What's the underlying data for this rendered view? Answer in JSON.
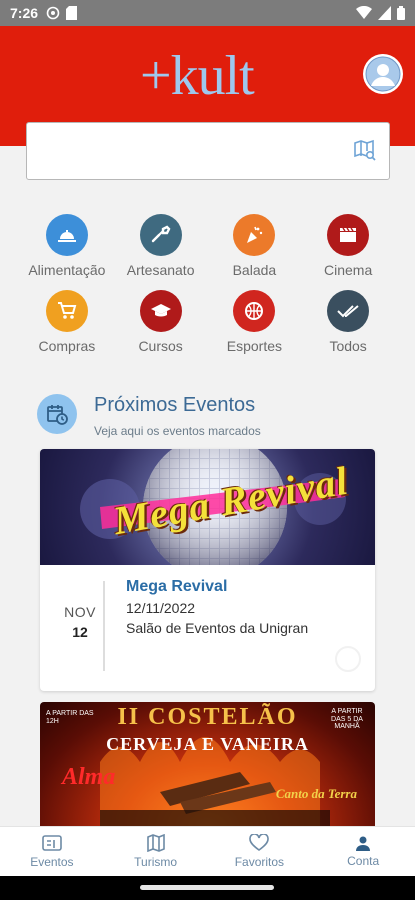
{
  "status_bar": {
    "time": "7:26"
  },
  "header": {
    "logo_text": "+kult",
    "colors": {
      "background": "#e01e0c",
      "logo": "#9ec8ee"
    }
  },
  "search": {
    "value": "",
    "placeholder": ""
  },
  "categories": [
    {
      "label": "Alimentação",
      "icon": "food-icon",
      "color": "#3d8fd9"
    },
    {
      "label": "Artesanato",
      "icon": "craft-icon",
      "color": "#3f6a80"
    },
    {
      "label": "Balada",
      "icon": "party-icon",
      "color": "#ec7a2a"
    },
    {
      "label": "Cinema",
      "icon": "clapper-icon",
      "color": "#b01a1a"
    },
    {
      "label": "Compras",
      "icon": "cart-icon",
      "color": "#f0a020"
    },
    {
      "label": "Cursos",
      "icon": "graduation-cap-icon",
      "color": "#b01a1a"
    },
    {
      "label": "Esportes",
      "icon": "basketball-icon",
      "color": "#d0261f"
    },
    {
      "label": "Todos",
      "icon": "double-check-icon",
      "color": "#3a4f5f"
    }
  ],
  "upcoming": {
    "title": "Próximos Eventos",
    "subtitle": "Veja aqui os eventos marcados"
  },
  "events": [
    {
      "banner_text": "Mega Revival",
      "month": "NOV",
      "day": "12",
      "name": "Mega Revival",
      "date": "12/11/2022",
      "place": "Salão de Eventos da Unigran"
    },
    {
      "banner_title": "II COSTELÃO",
      "banner_subtitle": "CERVEJA E VANEIRA",
      "banner_left": "A PARTIR DAS 12H",
      "banner_right": "A PARTIR DAS 5 DA MANHÃ",
      "band_1": "Alma",
      "band_2": "Canto da Terra"
    }
  ],
  "bottom_nav": [
    {
      "label": "Eventos",
      "icon": "events-icon"
    },
    {
      "label": "Turismo",
      "icon": "map-icon"
    },
    {
      "label": "Favoritos",
      "icon": "heart-icon"
    },
    {
      "label": "Conta",
      "icon": "person-icon"
    }
  ]
}
